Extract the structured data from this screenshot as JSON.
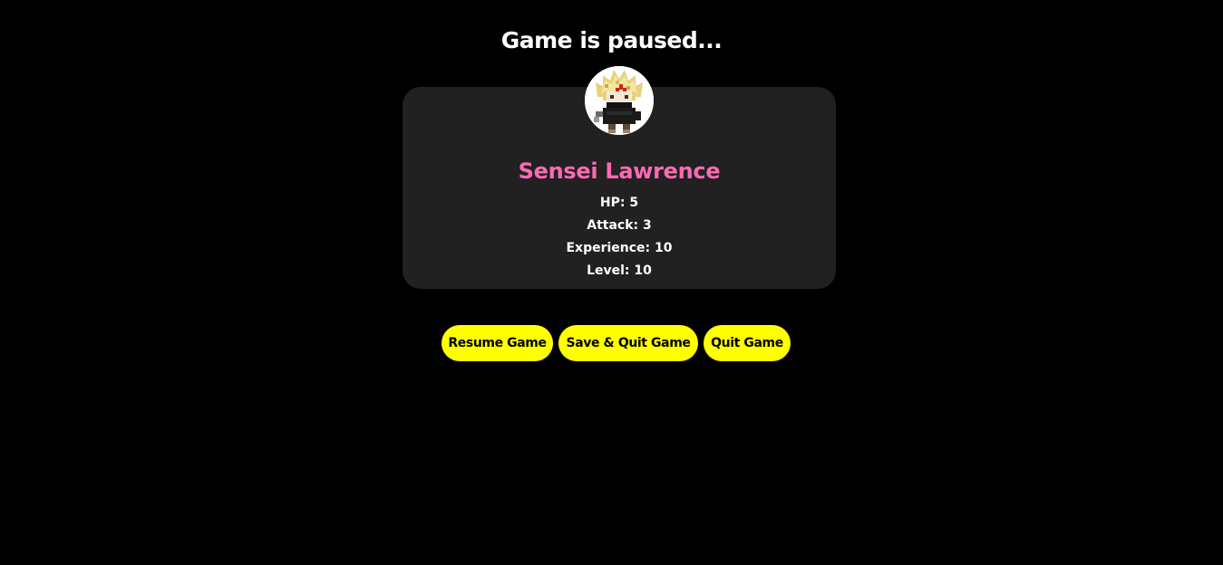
{
  "pause_title": "Game is paused...",
  "character": {
    "avatar_icon": "pixel-ninja-avatar-icon",
    "name": "Sensei Lawrence",
    "name_color": "#ff69b4",
    "stats": [
      {
        "label": "HP",
        "value": "5",
        "text": "HP: 5"
      },
      {
        "label": "Attack",
        "value": "3",
        "text": "Attack: 3"
      },
      {
        "label": "Experience",
        "value": "10",
        "text": "Experience: 10"
      },
      {
        "label": "Level",
        "value": "10",
        "text": "Level: 10"
      }
    ]
  },
  "buttons": {
    "resume": "Resume Game",
    "save_quit": "Save & Quit Game",
    "quit": "Quit Game"
  },
  "colors": {
    "background": "#000000",
    "card": "#212121",
    "button": "#ffff00",
    "button_text": "#000000",
    "text": "#ffffff"
  }
}
